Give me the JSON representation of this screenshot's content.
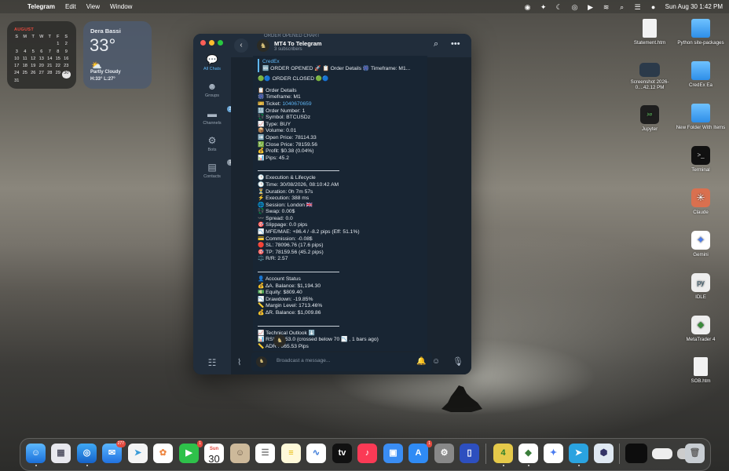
{
  "menubar": {
    "app": "Telegram",
    "items": [
      "Edit",
      "View",
      "Window"
    ],
    "datetime": "Sun Aug 30  1:42 PM"
  },
  "calendar": {
    "month": "AUGUST",
    "weekdays": [
      "S",
      "M",
      "T",
      "W",
      "T",
      "F",
      "S"
    ],
    "days": [
      "",
      "",
      "",
      "",
      "",
      "1",
      "2",
      "3",
      "4",
      "5",
      "6",
      "7",
      "8",
      "9",
      "10",
      "11",
      "12",
      "13",
      "14",
      "15",
      "16",
      "17",
      "18",
      "19",
      "20",
      "21",
      "22",
      "23",
      "24",
      "25",
      "26",
      "27",
      "28",
      "29",
      "30",
      "31"
    ],
    "today": "30"
  },
  "weather": {
    "city": "Dera Bassi",
    "temp": "33°",
    "condition": "Partly Cloudy",
    "hilo": "H:33° L:27°"
  },
  "desktop_icons": [
    "Statement.htm",
    "Python site-packages",
    "Screenshot 2026-0....42.12 PM",
    "CredEx Ea",
    "Jupyter",
    "New Folder With Items",
    "Terminal",
    "Claude",
    "Gemini",
    "IDLE",
    "MetaTrader 4",
    "SOB.htm"
  ],
  "telegram": {
    "sidebar": [
      {
        "label": "All Chats",
        "badge": ""
      },
      {
        "label": "Groups",
        "badge": ""
      },
      {
        "label": "Channels",
        "badge": "2"
      },
      {
        "label": "Bots",
        "badge": ""
      },
      {
        "label": "Contacts",
        "badge": "1"
      }
    ],
    "channel_title": "MT4 To Telegram",
    "channel_sub": "3 subscribers",
    "pinned_peek": "ORDER OPENED CHART",
    "reply_name": "CredEx",
    "reply_text": "🆕 ORDER OPENED 🚀 📋 Order Details 🎆 Timeframe: M1...",
    "closed_line": "🟢🔵 ORDER CLOSED 🟢🔵",
    "order": [
      "📋 Order Details",
      "🎆 Timeframe: M1",
      "🎫 Ticket: 1040670659",
      "🔢 Order Number: 1",
      "💱 Symbol: BTCUSDz",
      "📈 Type: BUY",
      "📦 Volume: 0.01",
      "➡️ Open Price: 78114.33",
      "💹 Close Price: 78159.56",
      "💰 Profit: $0.38 (0.04%)",
      "📊 Pips: 45.2"
    ],
    "ticket_label": "🎫 Ticket: ",
    "ticket_num": "1040670659",
    "exec": [
      "🕒 Execution & Lifecycle",
      "🕒 Time: 30/08/2026, 08:10:42 AM",
      "⏳ Duration: 0h 7m 57s",
      "⚡ Execution: 388 ms",
      "🌐 Session: London 🇬🇧",
      "💱 Swap: 0.00$",
      "〰️ Spread: 0.0",
      "🎯 Slippage: 0.0 pips",
      "📉 MFE/MAE: +86.4 / -8.2 pips (Eff: 51.1%)",
      "💳 Commission: -0.08$",
      "🔴 SL: 78096.76 (17.6 pips)",
      "🎯 TP: 78159.56 (45.2 pips)",
      "⚖️ R/R: 2.57"
    ],
    "account": [
      "👤 Account Status",
      "💰 ΔA. Balance: $1,194.30",
      "💵 Equity: $809.40",
      "📉 Drawdown: -19.85%",
      "📏 Margin Level: 1713.46%",
      "💰 ΔR. Balance: $1,009.86"
    ],
    "tech": [
      "📈 Technical Outlook ⬇️",
      "📊 RSI (9): 53.0 (crossed below 70 📉 , 1 bars ago)",
      "📏 ADR : 665.53 Pips"
    ],
    "input_placeholder": "Broadcast a message..."
  },
  "dock": {
    "mail_badge": "277",
    "facetime_badge": "1",
    "appstore_badge": "1",
    "calendar_day": "30",
    "calendar_month": "Sun"
  }
}
